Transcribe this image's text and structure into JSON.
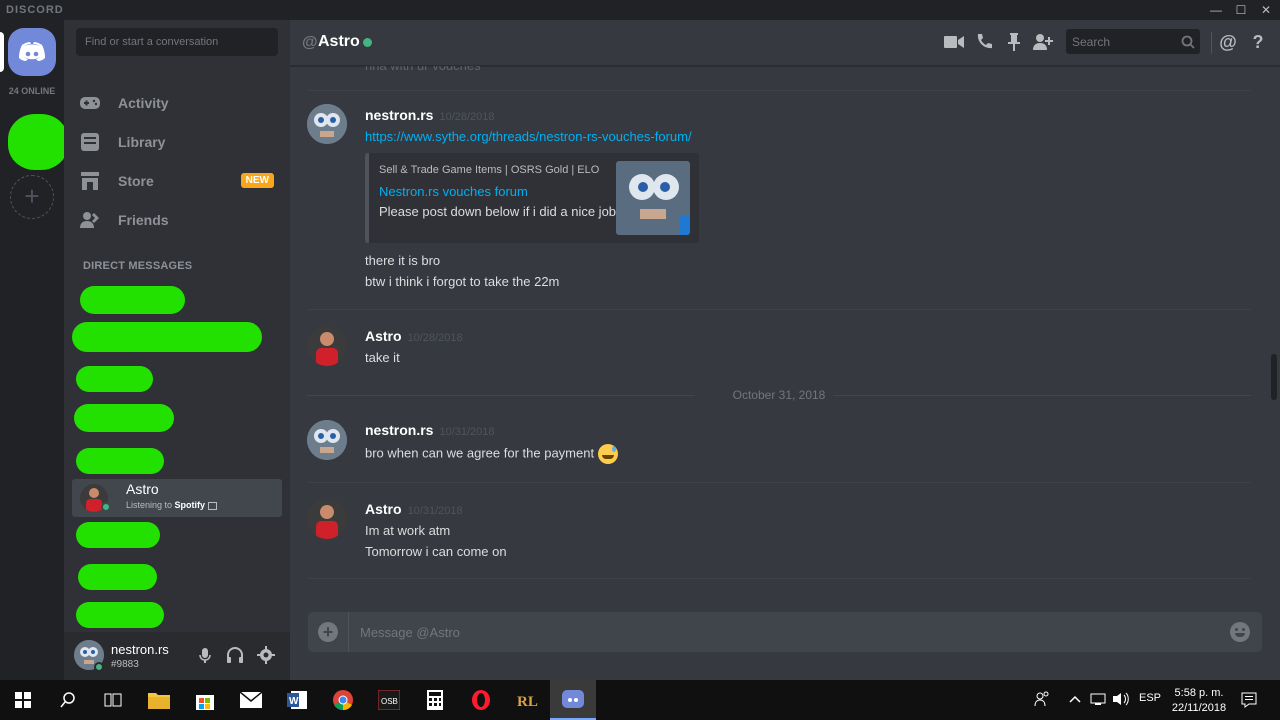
{
  "window": {
    "brand": "DISCORD",
    "minimize": "—",
    "maximize": "☐",
    "close": "✕"
  },
  "rail": {
    "online_count": "24 ONLINE"
  },
  "sidebar": {
    "search_placeholder": "Find or start a conversation",
    "nav": [
      {
        "label": "Activity",
        "icon": "gamepad-icon"
      },
      {
        "label": "Library",
        "icon": "library-icon"
      },
      {
        "label": "Store",
        "icon": "store-icon",
        "badge": "NEW"
      },
      {
        "label": "Friends",
        "icon": "friends-icon"
      }
    ],
    "dm_header": "DIRECT MESSAGES",
    "active_dm": {
      "name": "Astro",
      "status_prefix": "Listening to ",
      "status_app": "Spotify"
    },
    "user": {
      "name": "nestron.rs",
      "tag": "#9883"
    }
  },
  "chat": {
    "recipient": "Astro",
    "search_placeholder": "Search",
    "groups": [
      {
        "author": "nestron.rs",
        "time": "10/28/2018",
        "link": "https://www.sythe.org/threads/nestron-rs-vouches-forum/",
        "embed": {
          "provider": "Sell & Trade Game Items | OSRS Gold | ELO",
          "title": "Nestron.rs vouches forum",
          "description": "Please post down below if i did a nice job"
        },
        "lines": [
          "there it is bro",
          "btw i think i forgot to take the 22m"
        ]
      },
      {
        "author": "Astro",
        "time": "10/28/2018",
        "lines": [
          "take it"
        ]
      },
      {
        "author": "nestron.rs",
        "time": "10/31/2018",
        "lines": [
          "bro when can we agree for the payment"
        ]
      },
      {
        "author": "Astro",
        "time": "10/31/2018",
        "lines": [
          "Im at work atm",
          "Tomorrow i can come on"
        ]
      }
    ],
    "date_divider": "October 31, 2018",
    "composer_placeholder": "Message @Astro"
  },
  "taskbar": {
    "lang": "ESP",
    "time": "5:58 p. m.",
    "date": "22/11/2018"
  },
  "colors": {
    "blurple": "#7289da",
    "online": "#43b581",
    "link": "#00b0f4",
    "badge": "#faa61a",
    "redact": "#22e000"
  }
}
